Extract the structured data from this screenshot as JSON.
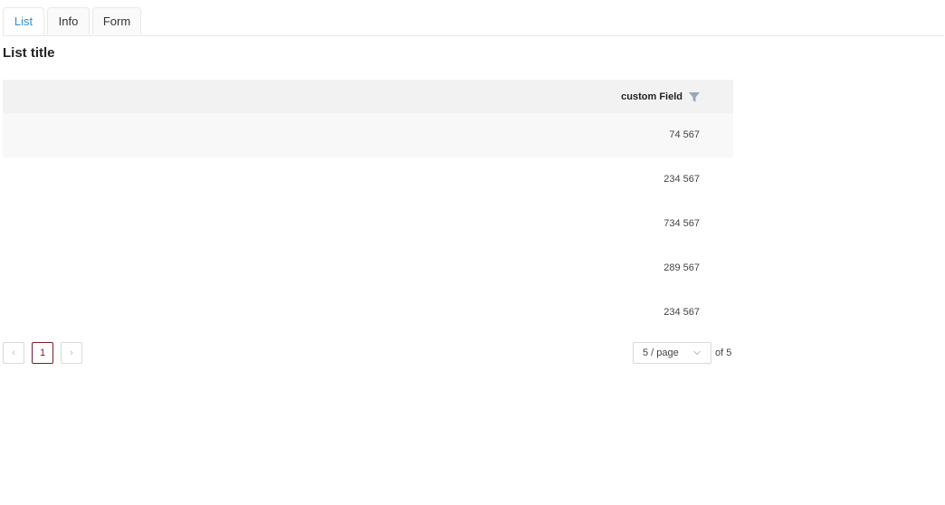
{
  "tabs": [
    {
      "label": "List",
      "active": true
    },
    {
      "label": "Info",
      "active": false
    },
    {
      "label": "Form",
      "active": false
    }
  ],
  "list_title": "List title",
  "table": {
    "columns": [
      {
        "label": "custom Field",
        "filterable": true
      }
    ],
    "rows": [
      "74 567",
      "234 567",
      "734 567",
      "289 567",
      "234 567"
    ]
  },
  "pagination": {
    "prev_icon": "‹",
    "next_icon": "›",
    "current_page": "1",
    "page_size": "5 / page",
    "total_text": "of 5"
  },
  "colors": {
    "active_tab": "#2d8fd0",
    "current_page_border": "#7a1a2a",
    "filter_icon": "#9aa7b5",
    "header_bg": "#f2f2f2"
  }
}
